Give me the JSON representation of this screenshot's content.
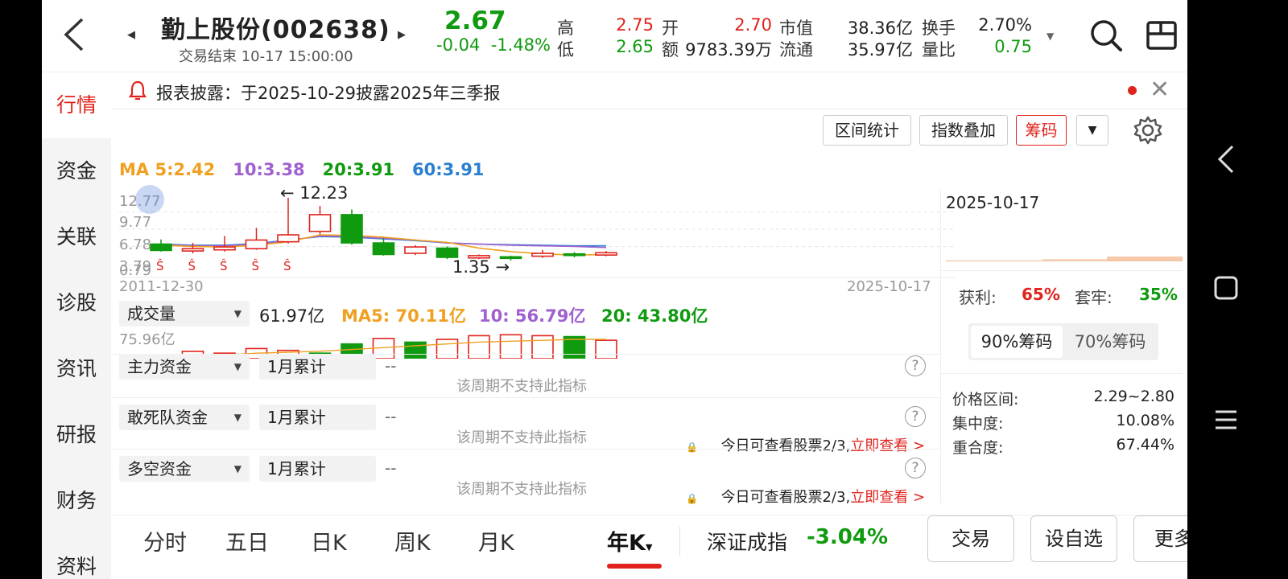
{
  "header": {
    "title": "勤上股份(002638)",
    "status": "交易结束 10-17 15:00:00",
    "price": "2.67",
    "change": "-0.04",
    "change_pct": "-1.48%",
    "high_label": "高",
    "high": "2.75",
    "low_label": "低",
    "low": "2.65",
    "open_label": "开",
    "open": "2.70",
    "amount_label": "额",
    "amount": "9783.39万",
    "mktcap_label": "市值",
    "mktcap": "38.36亿",
    "float_label": "流通",
    "float": "35.97亿",
    "turnover_label": "换手",
    "turnover": "2.70%",
    "volratio_label": "量比",
    "volratio": "0.75"
  },
  "nav": [
    "行情",
    "资金",
    "关联",
    "诊股",
    "资讯",
    "研报",
    "财务",
    "资料"
  ],
  "notice": "报表披露：于2025-10-29披露2025年三季报",
  "toolbar": {
    "range_stats": "区间统计",
    "index_overlay": "指数叠加",
    "chips": "筹码"
  },
  "ma": {
    "ma5": "MA 5:2.42",
    "ma10": "10:3.38",
    "ma20": "20:3.91",
    "ma60": "60:3.91"
  },
  "kline": {
    "max_label": "12.23",
    "min_label": "1.35",
    "y_ticks": [
      "12.77",
      "9.77",
      "6.78",
      "3.79",
      "0.79"
    ],
    "start_date": "2011-12-30",
    "end_date": "2025-10-17",
    "candles": [
      {
        "o": 4.2,
        "c": 3.1,
        "h": 5.0,
        "l": 2.9
      },
      {
        "o": 3.0,
        "c": 3.4,
        "h": 4.4,
        "l": 2.6
      },
      {
        "o": 3.2,
        "c": 3.7,
        "h": 5.6,
        "l": 2.9
      },
      {
        "o": 3.4,
        "c": 4.9,
        "h": 7.0,
        "l": 3.2
      },
      {
        "o": 4.6,
        "c": 5.8,
        "h": 12.23,
        "l": 4.3
      },
      {
        "o": 6.4,
        "c": 9.3,
        "h": 10.8,
        "l": 5.9
      },
      {
        "o": 9.3,
        "c": 4.4,
        "h": 10.2,
        "l": 4.1
      },
      {
        "o": 4.4,
        "c": 2.4,
        "h": 5.3,
        "l": 2.2
      },
      {
        "o": 2.6,
        "c": 3.7,
        "h": 4.0,
        "l": 2.3
      },
      {
        "o": 3.5,
        "c": 1.9,
        "h": 3.8,
        "l": 1.6
      },
      {
        "o": 1.8,
        "c": 2.2,
        "h": 2.4,
        "l": 1.6
      },
      {
        "o": 2.0,
        "c": 1.9,
        "h": 2.2,
        "l": 1.35
      },
      {
        "o": 2.1,
        "c": 2.6,
        "h": 3.2,
        "l": 1.8
      },
      {
        "o": 2.5,
        "c": 2.3,
        "h": 2.8,
        "l": 1.9
      },
      {
        "o": 2.3,
        "c": 2.7,
        "h": 3.0,
        "l": 2.1
      }
    ],
    "ma_a": [
      4.0,
      3.8,
      3.7,
      4.0,
      4.6,
      5.8,
      5.7,
      5.4,
      4.9,
      4.5,
      3.5,
      2.9,
      2.5,
      2.3,
      2.4
    ],
    "ma_b": [
      4.1,
      3.9,
      3.9,
      4.2,
      4.8,
      5.6,
      5.5,
      5.2,
      4.9,
      4.4,
      4.2,
      4.0,
      3.9,
      3.8,
      3.6
    ],
    "ma_c": [
      4.2,
      4.0,
      4.0,
      4.3,
      4.9,
      5.5,
      5.4,
      5.1,
      4.8,
      4.4,
      4.2,
      4.1,
      4.0,
      3.9,
      3.9
    ],
    "dividend_marks": [
      0,
      1,
      2,
      3,
      4
    ]
  },
  "volume": {
    "selector": "成交量",
    "value": "61.97亿",
    "ma5": "MA5: 70.11亿",
    "ma10": "10: 56.79亿",
    "ma20": "20: 43.80亿",
    "max_label": "75.96亿",
    "bars": [
      {
        "v": 2.5,
        "up": true
      },
      {
        "v": 8,
        "up": true
      },
      {
        "v": 6,
        "up": true
      },
      {
        "v": 11,
        "up": true
      },
      {
        "v": 9,
        "up": true
      },
      {
        "v": 6,
        "up": false
      },
      {
        "v": 16,
        "up": false
      },
      {
        "v": 22,
        "up": true
      },
      {
        "v": 18,
        "up": false
      },
      {
        "v": 21,
        "up": true
      },
      {
        "v": 25,
        "up": true
      },
      {
        "v": 26,
        "up": true
      },
      {
        "v": 25,
        "up": true
      },
      {
        "v": 24,
        "up": false
      },
      {
        "v": 20,
        "up": true
      }
    ]
  },
  "indicators": [
    {
      "name": "主力资金",
      "period": "1月累计",
      "value": "--",
      "note": "该周期不支持此指标",
      "quota": ""
    },
    {
      "name": "敢死队资金",
      "period": "1月累计",
      "value": "--",
      "note": "该周期不支持此指标",
      "quota": "今日可查看股票2/3,",
      "quota_link": "立即查看 >"
    },
    {
      "name": "多空资金",
      "period": "1月累计",
      "value": "--",
      "note": "该周期不支持此指标",
      "quota": "今日可查看股票2/3,",
      "quota_link": "立即查看 >"
    }
  ],
  "chip": {
    "date": "2025-10-17",
    "profit_label": "获利:",
    "profit": "65%",
    "trapped_label": "套牢:",
    "trapped": "35%",
    "tab90": "90%筹码",
    "tab70": "70%筹码",
    "range_label": "价格区间:",
    "range": "2.29~2.80",
    "conc_label": "集中度:",
    "conc": "10.08%",
    "overlap_label": "重合度:",
    "overlap": "67.44%"
  },
  "bottom": {
    "tabs": [
      "分时",
      "五日",
      "日K",
      "周K",
      "月K",
      "年K"
    ],
    "index_name": "深证成指",
    "index_chg": "-3.04%",
    "trade": "交易",
    "watchlist": "设自选",
    "more": "更多"
  },
  "colors": {
    "up": "#e0231c",
    "down": "#109a10",
    "ma5": "#f0a020",
    "ma10": "#a060d0",
    "ma20": "#109a10",
    "ma60": "#2a7fd0"
  }
}
